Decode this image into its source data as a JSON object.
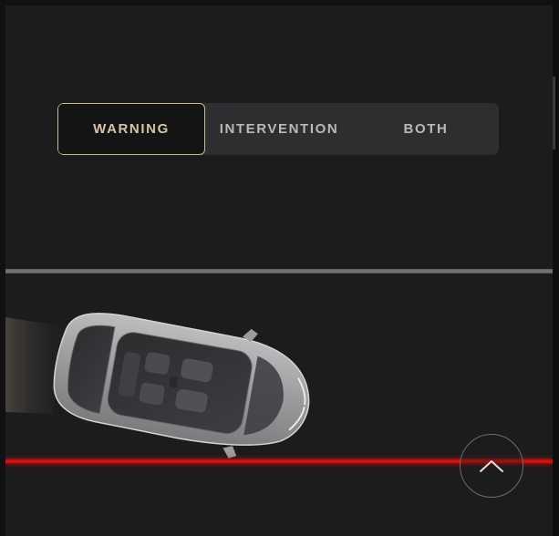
{
  "segmented_control": {
    "options": [
      {
        "label": "WARNING",
        "selected": true
      },
      {
        "label": "INTERVENTION",
        "selected": false
      },
      {
        "label": "BOTH",
        "selected": false
      }
    ]
  },
  "scene": {
    "icons": [
      "car-top-view",
      "chevron-up-icon"
    ],
    "colors": {
      "background": "#1c1c1d",
      "selected_border": "#cdb89a",
      "selected_text": "#d8c4a6",
      "lane_line": "#7c7c7e",
      "alert_lane_line": "#e3130f"
    }
  }
}
